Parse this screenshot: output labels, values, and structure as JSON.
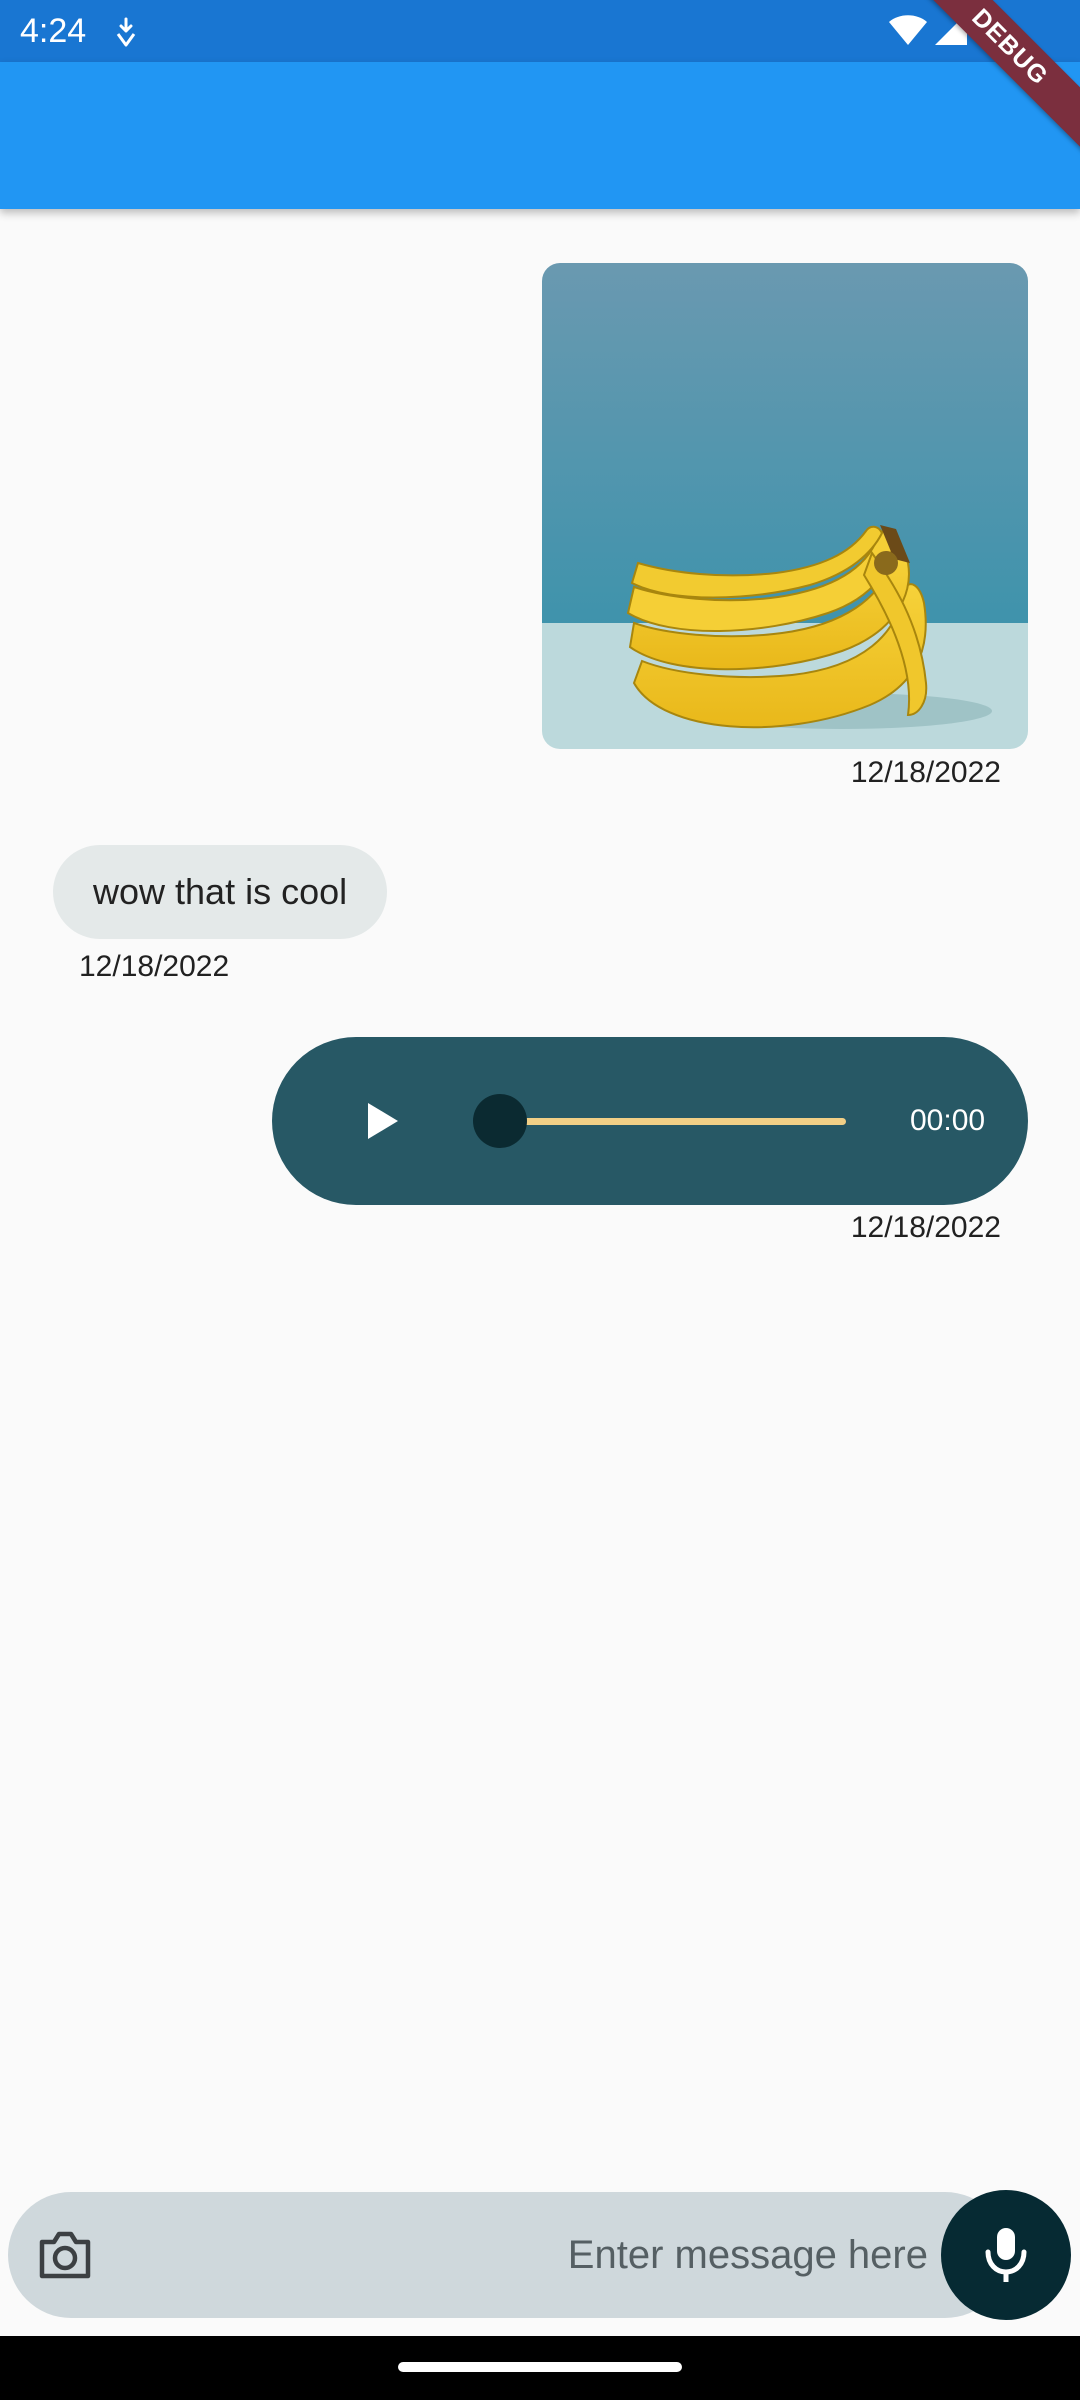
{
  "status_bar": {
    "time": "4:24",
    "notification_icon": "download-shield-icon",
    "wifi_icon": "wifi-icon",
    "signal_icon": "cell-signal-icon",
    "color": "#1976d2"
  },
  "app_bar": {
    "color": "#2196f3"
  },
  "debug_banner": {
    "label": "DEBUG"
  },
  "messages": [
    {
      "type": "image",
      "sender": "me",
      "image_description": "bananas",
      "timestamp": "12/18/2022"
    },
    {
      "type": "text",
      "sender": "other",
      "text": "wow that is cool",
      "timestamp": "12/18/2022"
    },
    {
      "type": "audio",
      "sender": "me",
      "duration": "00:00",
      "progress": 0,
      "timestamp": "12/18/2022"
    }
  ],
  "composer": {
    "camera_icon": "camera-icon",
    "placeholder": "Enter message here",
    "value": "",
    "mic_icon": "microphone-icon"
  },
  "colors": {
    "audio_bubble": "#275865",
    "seek_track": "#f1cf86",
    "text_bubble": "#e4e9e9",
    "composer": "#cfd8dc",
    "mic_button": "#062a33"
  }
}
